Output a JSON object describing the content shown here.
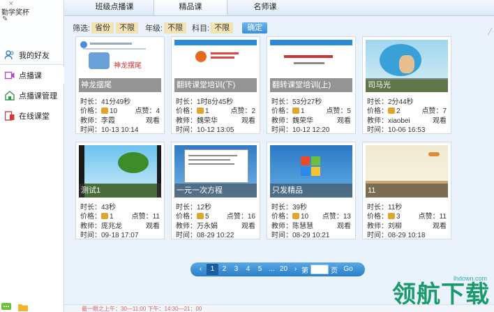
{
  "sidebar": {
    "award": "勤学奖杯",
    "items": [
      {
        "label": "我的好友",
        "icon": "friends-icon"
      },
      {
        "label": "点播课",
        "icon": "video-icon"
      },
      {
        "label": "点播课管理",
        "icon": "manage-icon"
      },
      {
        "label": "在线课堂",
        "icon": "online-class-icon"
      }
    ]
  },
  "tabs": [
    "班级点播课",
    "精品课",
    "名师课"
  ],
  "selected_tab": "精品课",
  "filters": {
    "label_filter": "筛选:",
    "chip_province": "省份",
    "chip_province_all": "不限",
    "label_grade": "年级:",
    "chip_grade_all": "不限",
    "label_subject": "科目:",
    "chip_subject_all": "不限",
    "confirm": "确定"
  },
  "labels": {
    "duration": "时长：",
    "price": "价格：",
    "likes": "点赞：",
    "teacher": "教师：",
    "time": "时间：",
    "watch": "观看"
  },
  "courses": [
    {
      "title": "神龙摆尾",
      "duration": "41分49秒",
      "price": "10",
      "likes": "4",
      "teacher": "李霞",
      "time": "10-13 10:14"
    },
    {
      "title": "翻转课堂培训(下)",
      "duration": "1时8分45秒",
      "price": "1",
      "likes": "2",
      "teacher": "魏荣华",
      "time": "10-12 13:05"
    },
    {
      "title": "翻转课堂培训(上)",
      "duration": "53分27秒",
      "price": "1",
      "likes": "5",
      "teacher": "魏荣华",
      "time": "10-12 12:20"
    },
    {
      "title": "司马光",
      "duration": "2分44秒",
      "price": "2",
      "likes": "7",
      "teacher": "xiaobei",
      "time": "10-06 16:53"
    },
    {
      "title": "测试1",
      "duration": "43秒",
      "price": "1",
      "likes": "11",
      "teacher": "庞兆龙",
      "time": "09-18 17:07"
    },
    {
      "title": "一元一次方程",
      "duration": "12秒",
      "price": "5",
      "likes": "16",
      "teacher": "万永娟",
      "time": "08-29 10:22"
    },
    {
      "title": "只发精品",
      "duration": "39秒",
      "price": "10",
      "likes": "13",
      "teacher": "陈慧慧",
      "time": "08-29 10:21"
    },
    {
      "title": "11",
      "duration": "11秒",
      "price": "3",
      "likes": "11",
      "teacher": "刘柳",
      "time": "08-29 10:18"
    }
  ],
  "thumb_texts": {
    "t0_banner": "神龙摆尾"
  },
  "pager": {
    "prev": "‹",
    "pages": [
      "1",
      "2",
      "3",
      "4",
      "5",
      "...",
      "20"
    ],
    "current": "1",
    "next": "›",
    "goto_prefix": "第",
    "goto_suffix": "页",
    "go": "Go"
  },
  "status": "最一眼之上午：30—11:00        下午：14:30—21：00",
  "watermark": {
    "text": "领航下载",
    "url": "lhdown.com"
  },
  "colors": {
    "accent": "#3b8fd6",
    "chip": "#f3e3b2",
    "brand_green": "#1a9a6a"
  }
}
